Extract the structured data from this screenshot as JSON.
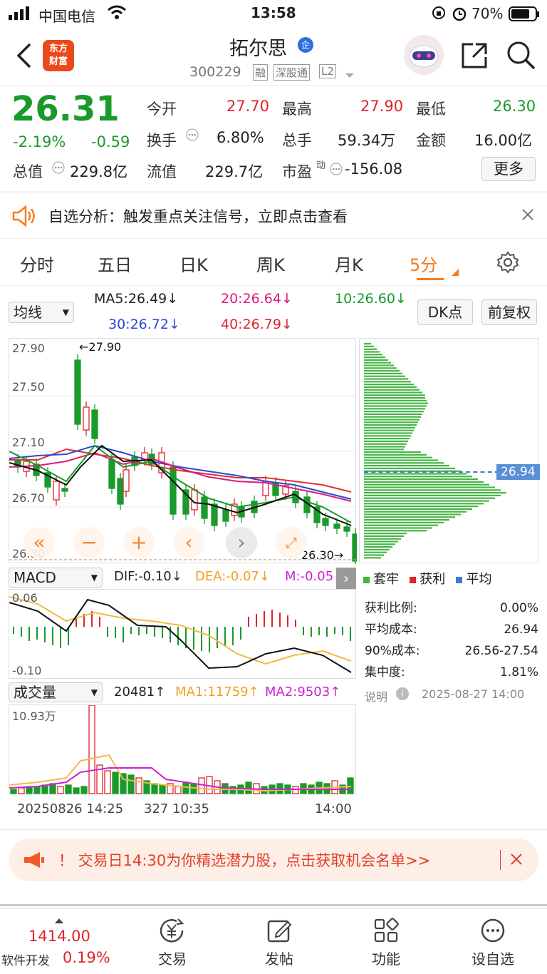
{
  "status": {
    "carrier": "中国电信",
    "time": "13:58",
    "battery": "70%"
  },
  "header": {
    "logo_line1": "东方",
    "logo_line2": "财富",
    "title": "拓尔思",
    "badge": "企",
    "code": "300229",
    "tag_rong": "融",
    "tag_sgt": "深股通",
    "tag_l2": "L2"
  },
  "quote": {
    "price": "26.31",
    "pct": "-2.19%",
    "chg": "-0.59",
    "open_label": "今开",
    "open": "27.70",
    "high_label": "最高",
    "high": "27.90",
    "low_label": "最低",
    "low": "26.30",
    "turn_label": "换手",
    "turn": "6.80%",
    "vol_label": "总手",
    "vol": "59.34万",
    "amt_label": "金额",
    "amt": "16.00亿",
    "mcap_label": "总值",
    "mcap": "229.8亿",
    "float_label": "流值",
    "float": "229.7亿",
    "pe_label": "市盈",
    "pe_sup": "动",
    "pe": "-156.08",
    "more": "更多"
  },
  "alert": {
    "text": "自选分析：触发重点关注信号，立即点击查看"
  },
  "tabs": [
    "分时",
    "五日",
    "日K",
    "周K",
    "月K",
    "5分"
  ],
  "ma": {
    "selector": "均线",
    "ma5": "MA5:26.49↓",
    "ma20": "20:26.64↓",
    "ma10": "10:26.60↓",
    "ma30": "30:26.72↓",
    "ma40": "40:26.79↓",
    "dk": "DK点",
    "fq": "前复权"
  },
  "kline": {
    "y_labels": [
      "27.90",
      "27.50",
      "27.10",
      "26.70",
      "26.30"
    ],
    "high_mark": "←27.90",
    "low_mark": "26.30→",
    "cost_tag": "26.94"
  },
  "macd": {
    "selector": "MACD",
    "dif": "DIF:-0.10↓",
    "dea": "DEA:-0.07↓",
    "m": "M:-0.05",
    "top": "0.06",
    "bottom": "-0.10"
  },
  "volume": {
    "selector": "成交量",
    "v": "20481↑",
    "ma1": "MA1:11759↑",
    "ma2": "MA2:9503↑",
    "max": "10.93万",
    "x_labels": [
      "20250826 14:25",
      "327 10:35",
      "14:00"
    ]
  },
  "chips": {
    "legend": [
      "套牢",
      "获利",
      "平均"
    ],
    "rows": [
      [
        "获利比例:",
        "0.00%"
      ],
      [
        "平均成本:",
        "26.94"
      ],
      [
        "90%成本:",
        "26.56-27.54"
      ],
      [
        "集中度:",
        "1.81%"
      ]
    ],
    "note": "说明",
    "date": "2025-08-27 14:00"
  },
  "banner": {
    "text": "！ 交易日14:30为你精选潜力股，点击获取机会名单>>"
  },
  "bottomnav": {
    "index_value": "1414.00",
    "index_name": "软件开发",
    "index_pct": "0.19%",
    "items": [
      "交易",
      "发帖",
      "功能",
      "设自选"
    ]
  },
  "colors": {
    "up": "#e0242c",
    "down": "#1a9a2a",
    "accent": "#f47b20"
  }
}
